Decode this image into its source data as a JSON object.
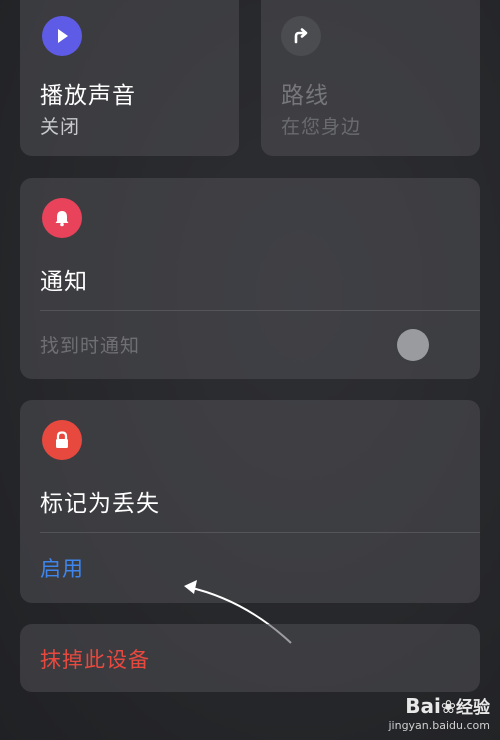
{
  "play_sound": {
    "title": "播放声音",
    "subtitle": "关闭",
    "icon": "play-icon",
    "icon_color": "#5e5ce6"
  },
  "directions": {
    "title": "路线",
    "subtitle": "在您身边",
    "icon": "turn-right-arrow-icon",
    "icon_color": "#4b4c50"
  },
  "notifications": {
    "title": "通知",
    "row_label": "找到时通知",
    "toggle_on": false,
    "icon": "bell-icon",
    "icon_color": "#e8435a"
  },
  "mark_as_lost": {
    "title": "标记为丢失",
    "action_label": "启用",
    "icon": "lock-icon",
    "icon_color": "#e8493f"
  },
  "erase_device": {
    "label": "抹掉此设备",
    "color": "#e8493f"
  },
  "watermark": {
    "brand": "Bai",
    "brand_suffix": "经验",
    "url": "jingyan.baidu.com"
  },
  "colors": {
    "link_blue": "#3e86ee",
    "text_dim": "#76777b"
  }
}
